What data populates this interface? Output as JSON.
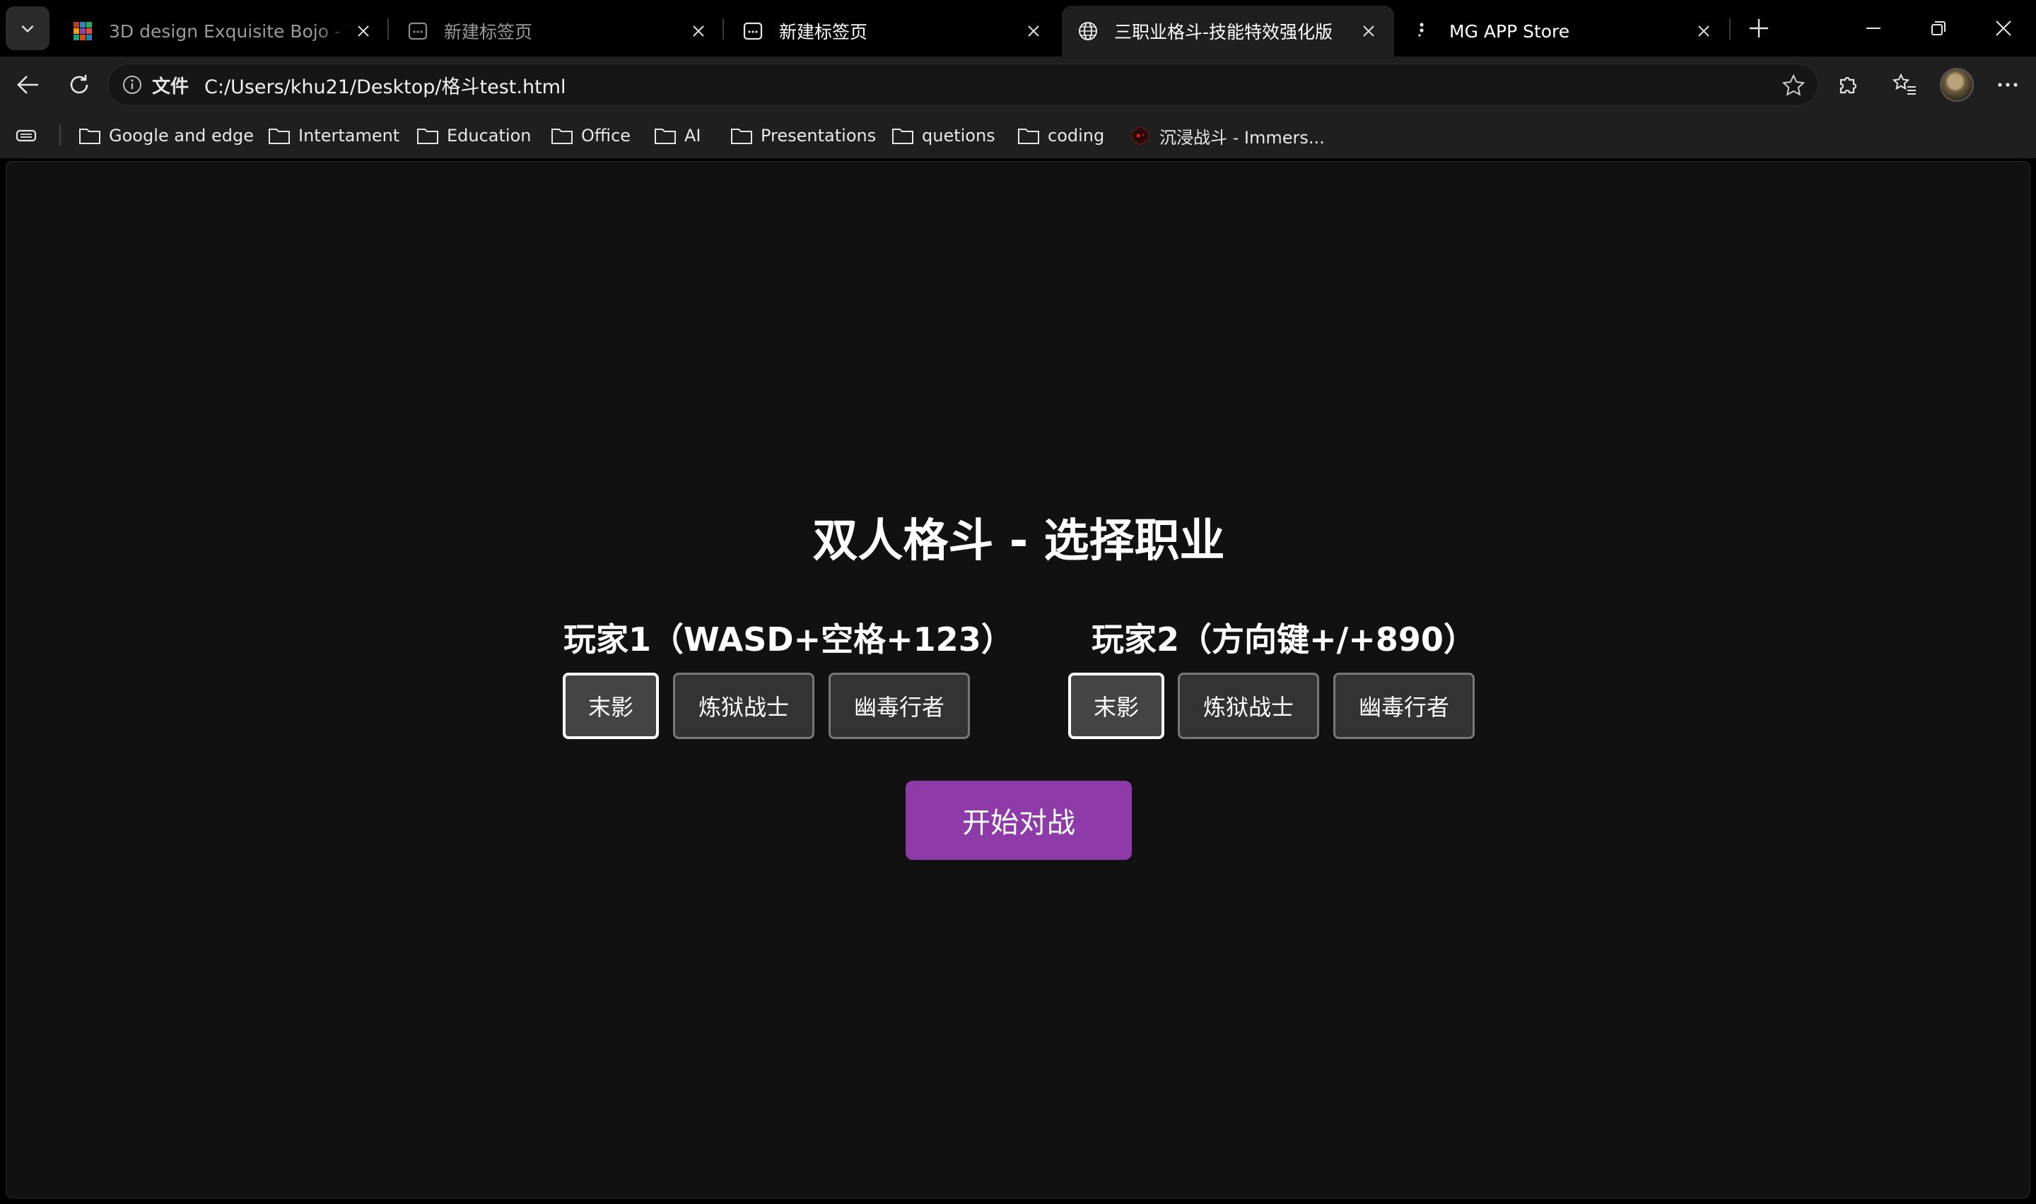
{
  "browser": {
    "tabs": [
      {
        "title": "3D design Exquisite Bojo - Tinkercad",
        "favicon": "tinkercad-icon",
        "active": false
      },
      {
        "title": "新建标签页",
        "favicon": "newtab-icon",
        "active": false
      },
      {
        "title": "新建标签页",
        "favicon": "newtab-icon",
        "active": false
      },
      {
        "title": "三职业格斗-技能特效强化版",
        "favicon": "globe-icon",
        "active": true
      },
      {
        "title": "MG APP Store",
        "favicon": "app-store-icon",
        "active": false
      }
    ],
    "address": {
      "scheme_label": "文件",
      "url": "C:/Users/khu21/Desktop/格斗test.html"
    },
    "bookmarks": [
      {
        "label": "Google and edge",
        "icon": "folder-icon"
      },
      {
        "label": "Intertament",
        "icon": "folder-icon"
      },
      {
        "label": "Education",
        "icon": "folder-icon"
      },
      {
        "label": "Office",
        "icon": "folder-icon"
      },
      {
        "label": "AI",
        "icon": "folder-icon"
      },
      {
        "label": "Presentations",
        "icon": "folder-icon"
      },
      {
        "label": "quetions",
        "icon": "folder-icon"
      },
      {
        "label": "coding",
        "icon": "folder-icon"
      },
      {
        "label": "沉浸战斗 - Immers...",
        "icon": "game-site-icon"
      }
    ]
  },
  "game": {
    "title": "双人格斗 - 选择职业",
    "player1": {
      "heading": "玩家1（WASD+空格+123）",
      "classes": [
        "末影",
        "炼狱战士",
        "幽毒行者"
      ],
      "selected": "末影"
    },
    "player2": {
      "heading": "玩家2（方向键+/+890）",
      "classes": [
        "末影",
        "炼狱战士",
        "幽毒行者"
      ],
      "selected": "末影"
    },
    "start_button": "开始对战"
  },
  "colors": {
    "page_background": "#111111",
    "start_button": "#8e3ba9",
    "class_button": "#333333",
    "selected_border": "#ffffff"
  }
}
